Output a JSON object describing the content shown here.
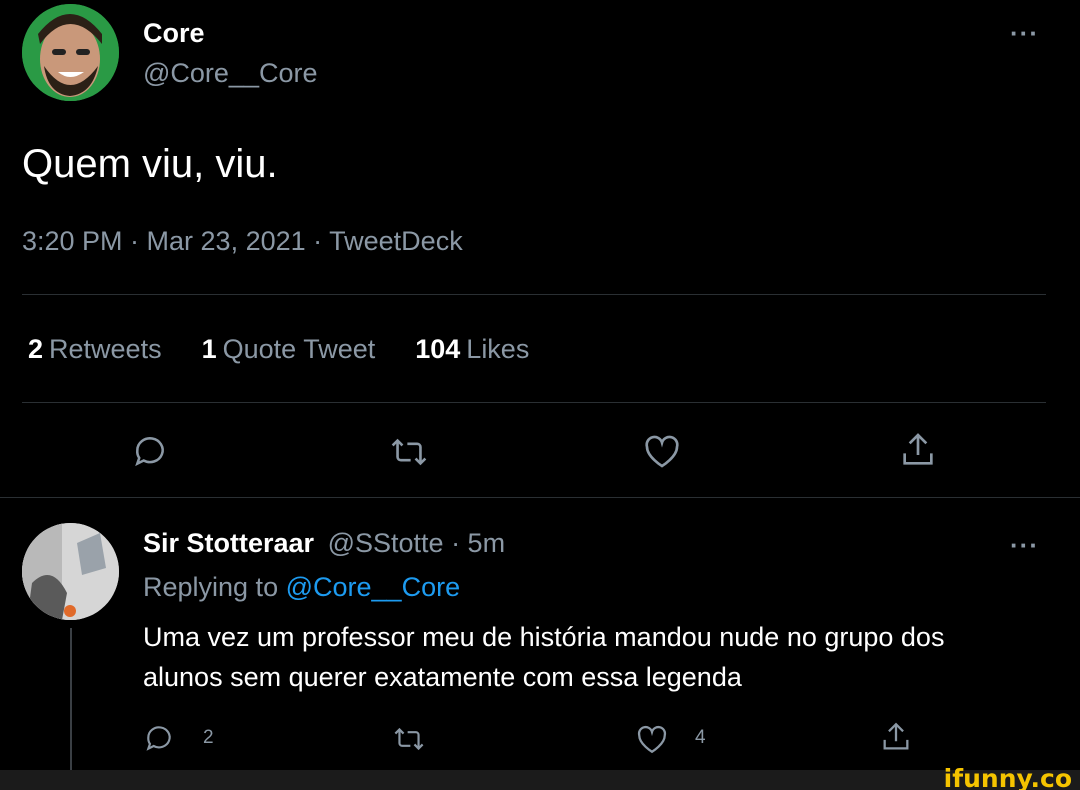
{
  "main_tweet": {
    "display_name": "Core",
    "handle": "@Core__Core",
    "more": "···",
    "text": "Quem viu, viu.",
    "meta": "3:20 PM · Mar 23, 2021 · TweetDeck",
    "stats": [
      {
        "count": "2",
        "label": "Retweets"
      },
      {
        "count": "1",
        "label": "Quote Tweet"
      },
      {
        "count": "104",
        "label": "Likes"
      }
    ],
    "actions": [
      "reply-icon",
      "retweet-icon",
      "like-icon",
      "share-icon"
    ]
  },
  "reply_tweet": {
    "display_name": "Sir Stotteraar",
    "handle": "@SStotte",
    "time": "· 5m",
    "more": "···",
    "replying_prefix": "Replying to",
    "replying_to": "@Core__Core",
    "text": "Uma vez um professor meu de história mandou nude no grupo dos alunos sem querer exatamente com essa legenda",
    "reply_count": "2",
    "like_count": "4"
  },
  "watermark": "ifunny.co",
  "colors": {
    "background": "#000000",
    "secondary_text": "#8b98a5",
    "link": "#1d9bf0",
    "watermark": "#f5c400"
  }
}
